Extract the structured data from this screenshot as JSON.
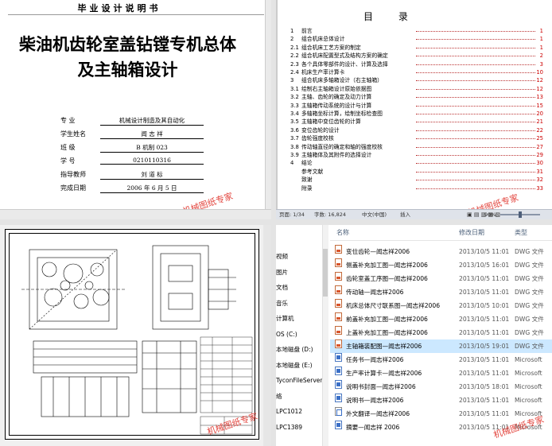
{
  "cover": {
    "header": "毕业设计说明书",
    "title_line1": "柴油机齿轮室盖钻镗专机总体",
    "title_line2": "及主轴箱设计",
    "fields": [
      {
        "label": "专 业",
        "value": "机械设计制造及其自动化"
      },
      {
        "label": "学生姓名",
        "value": "闻 志 祥"
      },
      {
        "label": "班 级",
        "value": "B 机制 023"
      },
      {
        "label": "学 号",
        "value": "0210110316"
      },
      {
        "label": "指导教师",
        "value": "刘 道 标"
      },
      {
        "label": "完成日期",
        "value": "2006 年 6 月 5 日"
      }
    ],
    "watermark": "机械图纸专家"
  },
  "toc": {
    "title": "目 录",
    "rows": [
      {
        "num": "1",
        "text": "前言",
        "page": "1"
      },
      {
        "num": "2",
        "text": "组合机床总体设计",
        "page": "1"
      },
      {
        "num": "2.1",
        "text": "组合机床工艺方案的制定",
        "page": "1"
      },
      {
        "num": "2.2",
        "text": "组合机床配置型式及结构方案的确定",
        "page": "2"
      },
      {
        "num": "2.3",
        "text": "各个具体零部件的设计、计算及选择",
        "page": "3"
      },
      {
        "num": "2.4",
        "text": "机床生产率计算卡",
        "page": "10"
      },
      {
        "num": "3",
        "text": "组合机床多轴箱设计（右主轴箱）",
        "page": "12"
      },
      {
        "num": "3.1",
        "text": "绘制右主轴箱设计原始依据图",
        "page": "12"
      },
      {
        "num": "3.2",
        "text": "主轴、齿轮的确定及动力计算",
        "page": "13"
      },
      {
        "num": "3.3",
        "text": "主轴箱传动系统的设计与计算",
        "page": "15"
      },
      {
        "num": "3.4",
        "text": "多轴箱坐标计算，绘制坐标检查图",
        "page": "20"
      },
      {
        "num": "3.5",
        "text": "主轴箱中变位齿轮的计算",
        "page": "21"
      },
      {
        "num": "3.6",
        "text": "变位齿轮的设计",
        "page": "22"
      },
      {
        "num": "3.7",
        "text": "齿轮强度校核",
        "page": "25"
      },
      {
        "num": "3.8",
        "text": "传动轴直径的确定和轴的强度校核",
        "page": "27"
      },
      {
        "num": "3.9",
        "text": "主轴箱体及其附件的选择设计",
        "page": "29"
      },
      {
        "num": "4",
        "text": "结论",
        "page": "30"
      },
      {
        "num": "",
        "text": "参考文献",
        "page": "31"
      },
      {
        "num": "",
        "text": "致谢",
        "page": "32"
      },
      {
        "num": "",
        "text": "附录",
        "page": "33"
      }
    ],
    "status": {
      "page": "页面: 1/34",
      "words": "字数: 16,824",
      "lang": "中文(中国)",
      "mode": "插入",
      "zoom": "90%"
    },
    "watermark": "机械图纸专家"
  },
  "cad": {
    "watermark": "机械图纸专家"
  },
  "explorer": {
    "nav": [
      "视频",
      "图片",
      "文档",
      "音乐",
      "计算机",
      "OS (C:)",
      "本地磁盘 (D:)",
      "本地磁盘 (E:)",
      "TyconFileServer",
      "络",
      "LPC1012",
      "LPC1389"
    ],
    "columns": {
      "name": "名称",
      "date": "修改日期",
      "type": "类型"
    },
    "files": [
      {
        "name": "变位齿轮—闻志祥2006",
        "date": "2013/10/5 11:01",
        "type": "DWG 文件",
        "icon": "dwg",
        "selected": false
      },
      {
        "name": "侧盖补充加工图—闻志祥2006",
        "date": "2013/10/5 16:01",
        "type": "DWG 文件",
        "icon": "dwg",
        "selected": false
      },
      {
        "name": "齿轮室盖工序图—闻志祥2006",
        "date": "2013/10/5 11:01",
        "type": "DWG 文件",
        "icon": "dwg",
        "selected": false
      },
      {
        "name": "传动轴—闻志祥2006",
        "date": "2013/10/5 11:01",
        "type": "DWG 文件",
        "icon": "dwg",
        "selected": false
      },
      {
        "name": "机床总体尺寸联系图—闻志祥2006",
        "date": "2013/10/5 10:01",
        "type": "DWG 文件",
        "icon": "dwg",
        "selected": false
      },
      {
        "name": "前盖补充加工图—闻志祥2006",
        "date": "2013/10/5 11:01",
        "type": "DWG 文件",
        "icon": "dwg",
        "selected": false
      },
      {
        "name": "上盖补充加工图—闻志祥2006",
        "date": "2013/10/5 11:01",
        "type": "DWG 文件",
        "icon": "dwg",
        "selected": false
      },
      {
        "name": "主轴箱装配图—闻志祥2006",
        "date": "2013/10/5 19:01",
        "type": "DWG 文件",
        "icon": "dwg",
        "selected": true
      },
      {
        "name": "任务书—闻志祥2006",
        "date": "2013/10/5 11:01",
        "type": "Microsoft",
        "icon": "doc",
        "selected": false
      },
      {
        "name": "生产率计算卡—闻志祥2006",
        "date": "2013/10/5 11:01",
        "type": "Microsoft",
        "icon": "doc",
        "selected": false
      },
      {
        "name": "说明书封面—闻志祥2006",
        "date": "2013/10/5 18:01",
        "type": "Microsoft",
        "icon": "doc",
        "selected": false
      },
      {
        "name": "说明书—闻志祥2006",
        "date": "2013/10/5 11:01",
        "type": "Microsoft",
        "icon": "doc",
        "selected": false
      },
      {
        "name": "外文翻译—闻志祥2006",
        "date": "2013/10/5 11:01",
        "type": "Microsoft",
        "icon": "doc2",
        "selected": false
      },
      {
        "name": "摘要—闻志祥 2006",
        "date": "2013/10/5 11:01",
        "type": "Microsoft",
        "icon": "doc",
        "selected": false
      }
    ],
    "watermark": "机械图纸专家"
  }
}
